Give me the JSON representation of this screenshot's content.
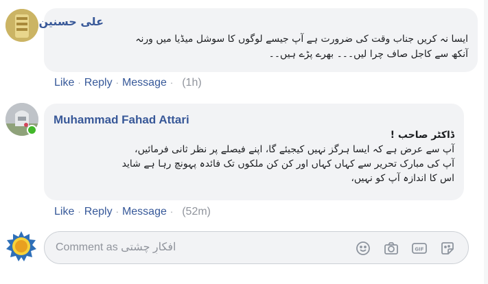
{
  "comments": [
    {
      "author": "علی حسنین",
      "lines": [
        "ایسا نہ کریں جناب وقت کی ضرورت ہے آپ جیسے لوگوں کا سوشل میڈیا میں ورنہ",
        "آنکھ سے کاجل صاف چرا لیں۔۔۔ بھرے پڑے ہیں۔۔"
      ],
      "actions": {
        "like": "Like",
        "reply": "Reply",
        "message": "Message",
        "time": "(1h)"
      }
    },
    {
      "author": "Muhammad Fahad Attari",
      "lines": [
        "ڈاکٹر صاحب !",
        "آپ سے عرض ہے کہ ایسا ہرگز نہیں کیجیئے گا، اپنے فیصلے پر نظر ثانی فرمائیں،",
        "آپ کی مبارک تحریر سے کہاں کہاں اور کن کن ملکوں تک فائدہ پہونچ رہا ہے شاید",
        "اس کا اندازہ آپ کو نہیں،"
      ],
      "actions": {
        "like": "Like",
        "reply": "Reply",
        "message": "Message",
        "time": "(52m)"
      }
    }
  ],
  "composer": {
    "placeholder": "Comment as افکارِ چشتی"
  },
  "icons": [
    "emoji-icon",
    "camera-icon",
    "gif-icon",
    "sticker-icon"
  ],
  "colors": {
    "link": "#385898",
    "bubble": "#f2f3f5",
    "online": "#42b72a"
  }
}
